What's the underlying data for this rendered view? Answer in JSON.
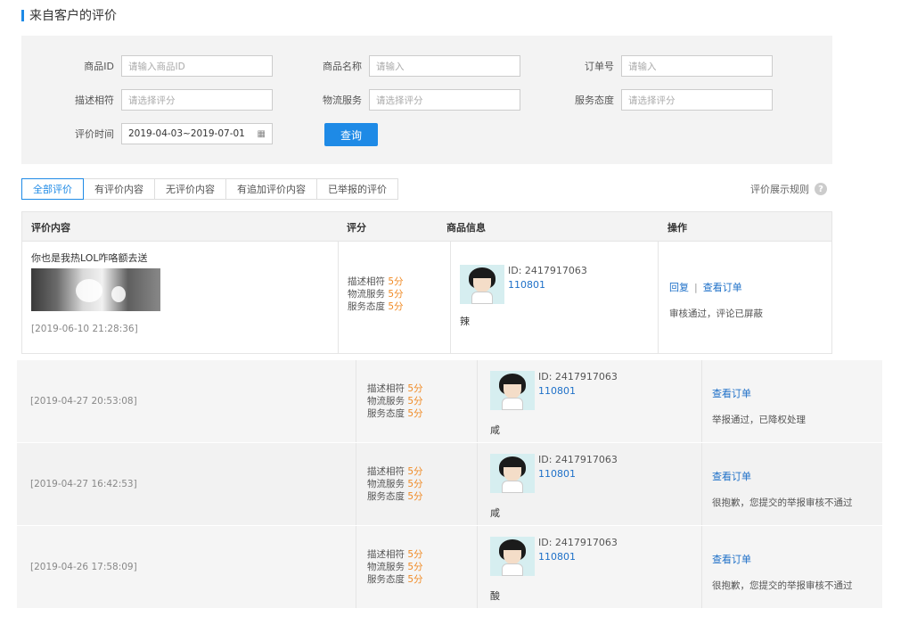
{
  "page": {
    "title": "来自客户的评价"
  },
  "filters": {
    "product_id": {
      "label": "商品ID",
      "placeholder": "请输入商品ID"
    },
    "product_name": {
      "label": "商品名称",
      "placeholder": "请输入"
    },
    "order_no": {
      "label": "订单号",
      "placeholder": "请输入"
    },
    "desc_match": {
      "label": "描述相符",
      "placeholder": "请选择评分"
    },
    "logistics": {
      "label": "物流服务",
      "placeholder": "请选择评分"
    },
    "service": {
      "label": "服务态度",
      "placeholder": "请选择评分"
    },
    "date": {
      "label": "评价时间",
      "value": "2019-04-03~2019-07-01",
      "icon": "calendar-icon"
    },
    "query_button": "查询"
  },
  "tabs": [
    {
      "label": "全部评价",
      "active": true
    },
    {
      "label": "有评价内容"
    },
    {
      "label": "无评价内容"
    },
    {
      "label": "有追加评价内容"
    },
    {
      "label": "已举报的评价"
    }
  ],
  "rules_link": "评价展示规则",
  "table": {
    "headers": [
      "评价内容",
      "评分",
      "商品信息",
      "操作"
    ]
  },
  "score_labels": {
    "desc": "描述相符",
    "logistics": "物流服务",
    "service": "服务态度"
  },
  "rows": [
    {
      "comment": "你也是我热LOL咋咯额去送",
      "time": "[2019-06-10 21:28:36]",
      "scores": {
        "desc": "5分",
        "logistics": "5分",
        "service": "5分"
      },
      "product": {
        "id": "ID: 2417917063",
        "name": "110801",
        "char": "辣"
      },
      "actions": {
        "reply": "回复",
        "separator": "|",
        "view": "查看订单"
      },
      "status": "审核通过，评论已屏蔽"
    },
    {
      "time": "[2019-04-27 20:53:08]",
      "scores": {
        "desc": "5分",
        "logistics": "5分",
        "service": "5分"
      },
      "product": {
        "id": "ID: 2417917063",
        "name": "110801",
        "char": "咸"
      },
      "actions": {
        "view": "查看订单"
      },
      "status": "举报通过，已降权处理"
    },
    {
      "time": "[2019-04-27 16:42:53]",
      "scores": {
        "desc": "5分",
        "logistics": "5分",
        "service": "5分"
      },
      "product": {
        "id": "ID: 2417917063",
        "name": "110801",
        "char": "咸"
      },
      "actions": {
        "view": "查看订单"
      },
      "status": "很抱歉，您提交的举报审核不通过"
    },
    {
      "time": "[2019-04-26 17:58:09]",
      "scores": {
        "desc": "5分",
        "logistics": "5分",
        "service": "5分"
      },
      "product": {
        "id": "ID: 2417917063",
        "name": "110801",
        "char": "酸"
      },
      "actions": {
        "view": "查看订单"
      },
      "status": "很抱歉，您提交的举报审核不通过"
    }
  ],
  "colors": {
    "accent": "#1e8ae6",
    "score": "#f08a24",
    "link": "#1e70c8"
  }
}
